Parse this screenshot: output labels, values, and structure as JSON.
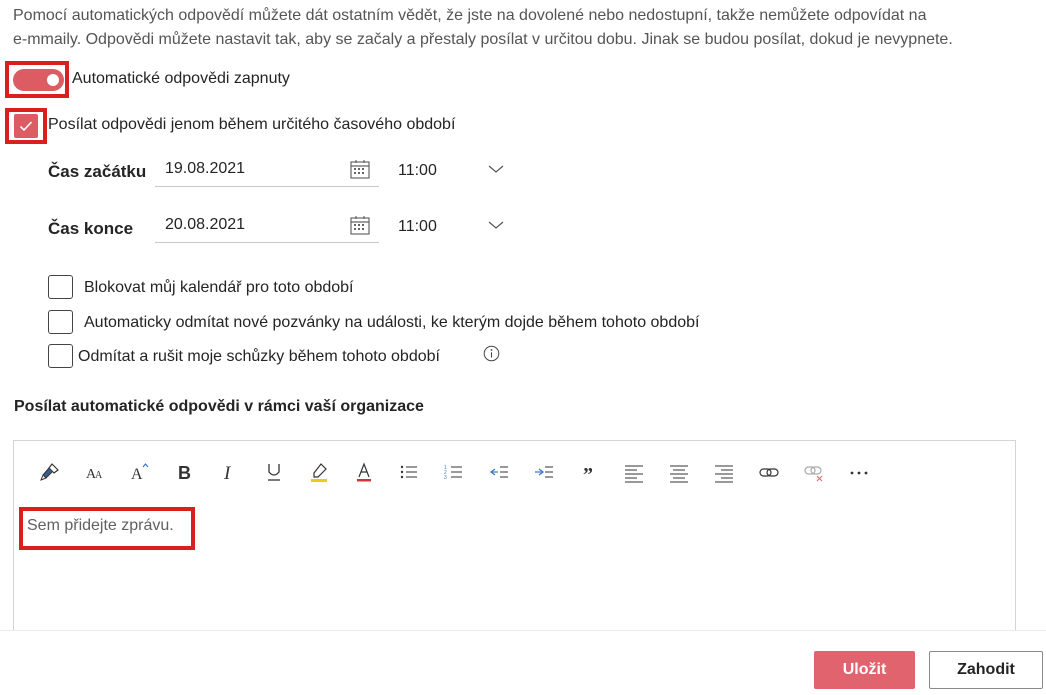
{
  "intro": {
    "line1": "Pomocí automatických odpovědí můžete dát ostatním vědět, že jste na dovolené nebo nedostupní, takže nemůžete odpovídat na",
    "line2": "e-mmaily. Odpovědi můžete nastavit tak, aby se začaly a přestaly posílat v určitou dobu. Jinak se budou posílat, dokud je nevypnete."
  },
  "auto_reply": {
    "label": "Automatické odpovědi zapnuty",
    "on": true
  },
  "time_period": {
    "label": "Posílat odpovědi jenom během určitého časového období",
    "checked": true
  },
  "start": {
    "label": "Čas začátku",
    "date": "19.08.2021",
    "time": "11:00"
  },
  "end": {
    "label": "Čas konce",
    "date": "20.08.2021",
    "time": "11:00"
  },
  "options": [
    {
      "label": "Blokovat můj kalendář pro toto období",
      "checked": false
    },
    {
      "label": "Automaticky odmítat nové pozvánky na události, ke kterým dojde během tohoto období",
      "checked": false
    },
    {
      "label": "Odmítat a rušit moje schůzky během tohoto období",
      "checked": false
    }
  ],
  "section_title": "Posílat automatické odpovědi v rámci vaší organizace",
  "toolbar": [
    "format-painter-icon",
    "font-size-icon",
    "grow-font-icon",
    "bold-icon",
    "italic-icon",
    "underline-icon",
    "highlight-icon",
    "font-color-icon",
    "bullets-icon",
    "numbering-icon",
    "decrease-indent-icon",
    "increase-indent-icon",
    "quote-icon",
    "align-left-icon",
    "align-center-icon",
    "align-right-icon",
    "link-icon",
    "remove-link-icon",
    "more-icon"
  ],
  "editor": {
    "placeholder": "Sem přidejte zprávu."
  },
  "buttons": {
    "save": "Uložit",
    "discard": "Zahodit"
  },
  "colors": {
    "accent": "#dd5b62",
    "highlight_box": "#d9201f"
  }
}
